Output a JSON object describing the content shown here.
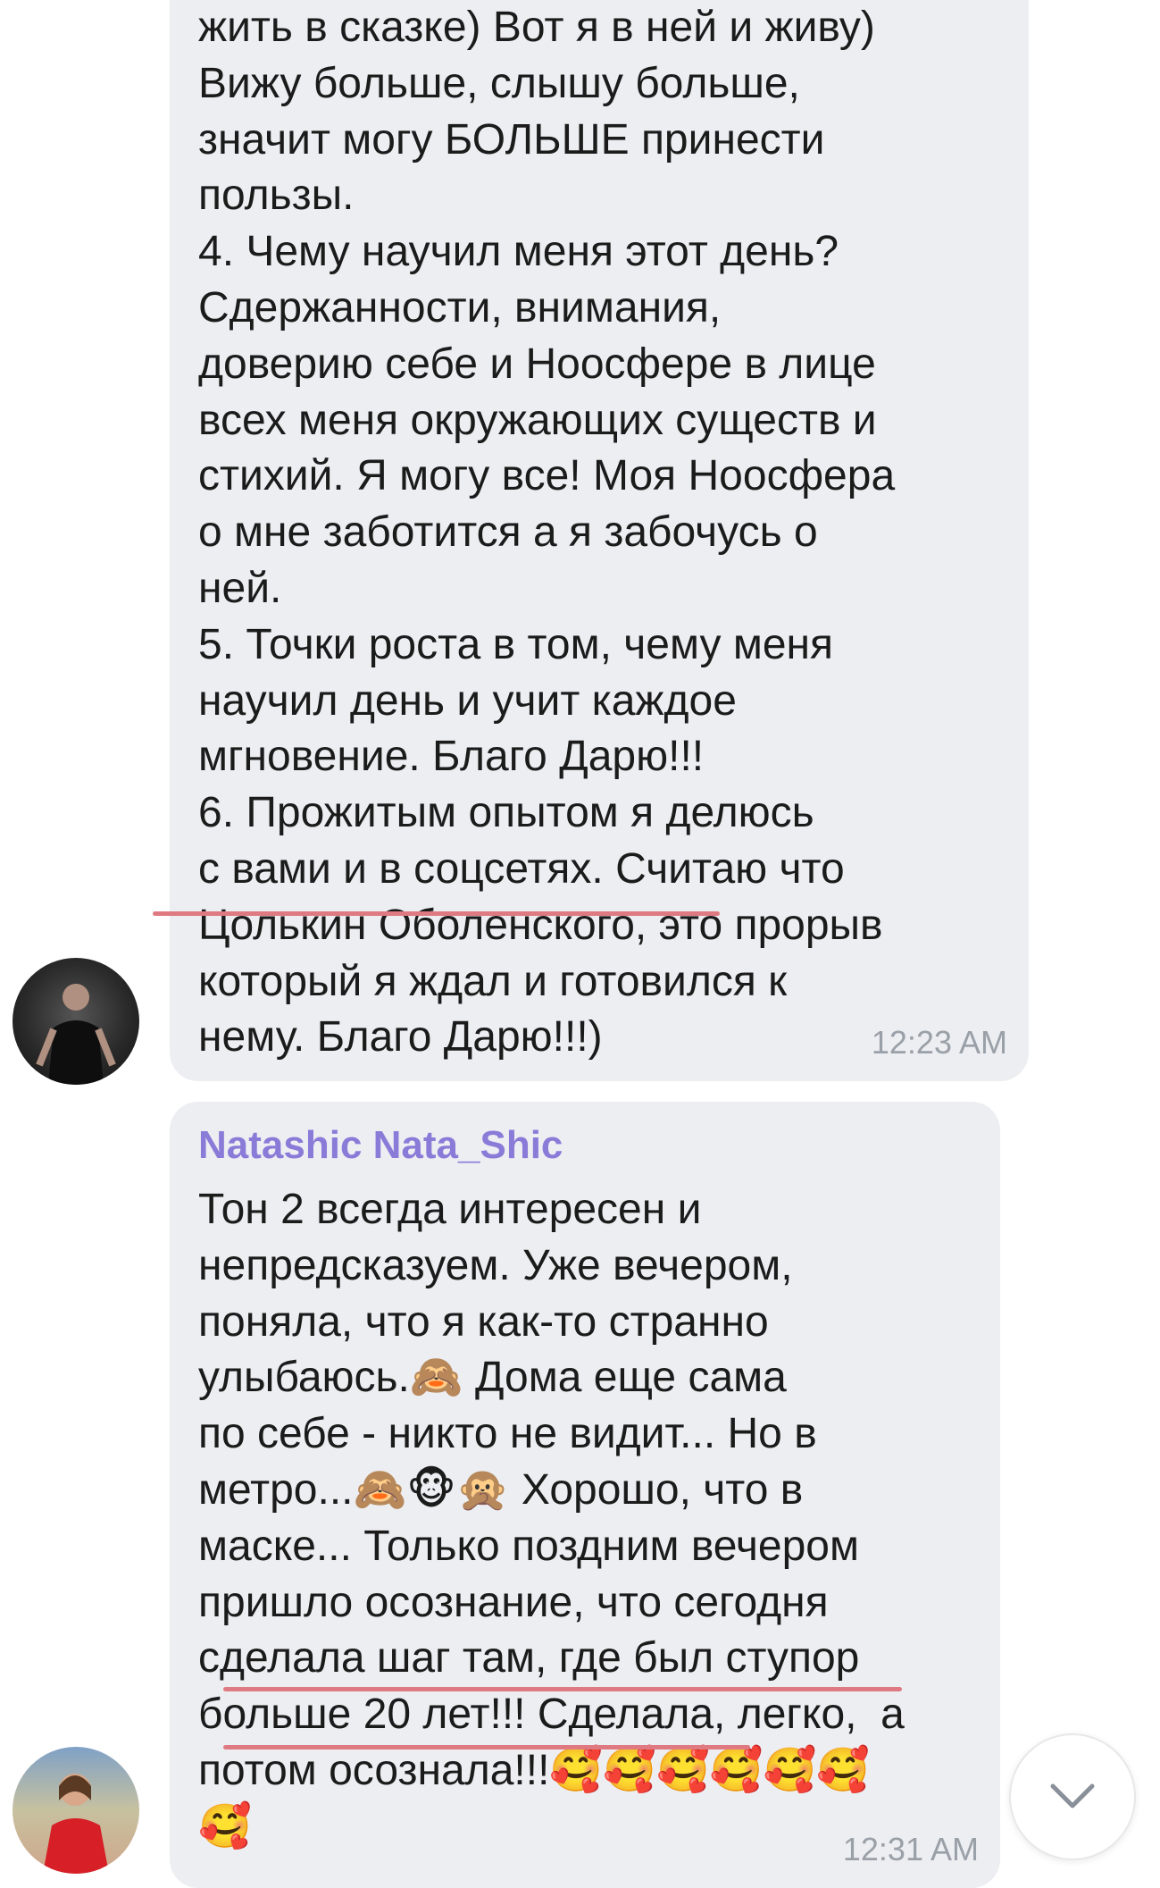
{
  "messages": [
    {
      "text": "жить в сказке) Вот я в ней и живу)\nВижу больше, слышу больше,\nзначит могу БОЛЬШЕ принести\nпользы.\n4. Чему научил меня этот день?\nСдержанности, внимания,\nдоверию себе и Ноосфере в лице\nвсех меня окружающих существ и\nстихий. Я могу все! Моя Ноосфера\nо мне заботится а я забочусь о\nней.\n5. Точки роста в том, чему меня\nнаучил день и учит каждое\nмгновение. Благо Дарю!!!\n6. Прожитым опытом я делюсь\nс вами и в соцсетях. Считаю что\nЦолькин Оболенского, это прорыв\nкоторый я ждал и готовился к\nнему. Благо Дарю!!!)",
      "time": "12:23 AM"
    },
    {
      "sender": "Natashic Nata_Shic",
      "text": "Тон 2 всегда интересен и\nнепредсказуем. Уже вечером,\nпоняла, что я как-то странно\nулыбаюсь.🙈 Дома еще сама\nпо себе - никто не видит... Но в\nметро...🙈🐵🙊 Хорошо, что в\nмаске... Только поздним вечером\nпришло осознание, что сегодня\nсделала шаг там, где был ступор\nбольше 20 лет!!! Сделала, легко,  а\nпотом осознала!!!🥰🥰🥰🥰🥰🥰\n🥰",
      "time": "12:31 AM"
    }
  ],
  "icons": {
    "scroll_down": "chevron-down-icon",
    "avatar_1": "user-avatar-man",
    "avatar_2": "user-avatar-woman"
  },
  "colors": {
    "bubble": "#edeef2",
    "sender": "#8b7bd8",
    "underline": "#e07a82",
    "time": "#9aa0a8"
  }
}
